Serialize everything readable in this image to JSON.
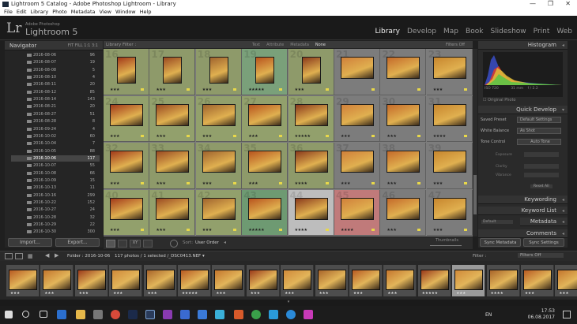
{
  "window": {
    "title": "Lightroom 5 Catalog - Adobe Photoshop Lightroom - Library",
    "min": "—",
    "max": "❐",
    "close": "✕"
  },
  "menu": [
    "File",
    "Edit",
    "Library",
    "Photo",
    "Metadata",
    "View",
    "Window",
    "Help"
  ],
  "identity": {
    "logo": "Lr",
    "brand_small": "Adobe Photoshop",
    "brand_large": "Lightroom 5"
  },
  "modules": [
    "Library",
    "Develop",
    "Map",
    "Book",
    "Slideshow",
    "Print",
    "Web"
  ],
  "navigator": {
    "title": "Navigator",
    "zoom_options": "FIT  FILL  1:1  3:1"
  },
  "folders": [
    {
      "name": "2016-08-06",
      "count": "96"
    },
    {
      "name": "2016-08-07",
      "count": "19"
    },
    {
      "name": "2016-08-08",
      "count": "5"
    },
    {
      "name": "2016-08-10",
      "count": "4"
    },
    {
      "name": "2016-08-11",
      "count": "20"
    },
    {
      "name": "2016-08-12",
      "count": "85"
    },
    {
      "name": "2016-08-14",
      "count": "143"
    },
    {
      "name": "2016-08-21",
      "count": "20"
    },
    {
      "name": "2016-08-27",
      "count": "51"
    },
    {
      "name": "2016-08-28",
      "count": "8"
    },
    {
      "name": "2016-09-24",
      "count": "4"
    },
    {
      "name": "2016-10-02",
      "count": "60"
    },
    {
      "name": "2016-10-04",
      "count": "7"
    },
    {
      "name": "2016-10-05",
      "count": "88"
    },
    {
      "name": "2016-10-06",
      "count": "117"
    },
    {
      "name": "2016-10-07",
      "count": "55"
    },
    {
      "name": "2016-10-08",
      "count": "66"
    },
    {
      "name": "2016-10-09",
      "count": "15"
    },
    {
      "name": "2016-10-13",
      "count": "11"
    },
    {
      "name": "2016-10-16",
      "count": "299"
    },
    {
      "name": "2016-10-22",
      "count": "152"
    },
    {
      "name": "2016-10-27",
      "count": "24"
    },
    {
      "name": "2016-10-28",
      "count": "32"
    },
    {
      "name": "2016-10-29",
      "count": "22"
    },
    {
      "name": "2016-10-30",
      "count": "300"
    }
  ],
  "selected_folder_index": 14,
  "left_buttons": {
    "import": "Import...",
    "export": "Export..."
  },
  "filterbar": {
    "label": "Library Filter :",
    "tabs": [
      "Text",
      "Attribute",
      "Metadata",
      "None"
    ],
    "active_tab": "None",
    "filters": "Filters Off"
  },
  "grid_numbers": [
    "16",
    "17",
    "18",
    "19",
    "20",
    "21",
    "22",
    "23",
    "24",
    "25",
    "26",
    "27",
    "28",
    "29",
    "30",
    "31",
    "32",
    "33",
    "34",
    "35",
    "36",
    "37",
    "38",
    "39",
    "40",
    "41",
    "42",
    "43",
    "44",
    "45",
    "46",
    "47"
  ],
  "grid_stars": [
    "★★★",
    "★★★",
    "★★★",
    "★★★★★",
    "★★★",
    "",
    "",
    "★★★",
    "★★★",
    "★★★",
    "★★★",
    "★★★",
    "★★★★★",
    "★★★",
    "★★★",
    "★★★★",
    "★★★",
    "★★★",
    "★★★",
    "★★★",
    "★★★★",
    "★★★",
    "★★★",
    "★★★",
    "★★★",
    "★★★",
    "★★★",
    "★★★★★",
    "★★★★",
    "★★★★",
    "★★★",
    "★★★"
  ],
  "grid_toolbar": {
    "sort_label": "Sort:",
    "sort_value": "User Order",
    "thumbs_label": "Thumbnails"
  },
  "right": {
    "histogram": "Histogram",
    "exif": {
      "iso": "ISO 720",
      "focal": "31 mm",
      "aperture": "f / 2.2",
      "shutter": "1/60 sec"
    },
    "original_photo": "Original Photo",
    "quick_develop": "Quick Develop",
    "saved_preset_label": "Saved Preset",
    "saved_preset": "Default Settings",
    "wb_label": "White Balance",
    "wb_value": "As Shot",
    "tone_label": "Tone Control",
    "auto_tone": "Auto Tone",
    "exposure": "Exposure",
    "clarity": "Clarity",
    "vibrance": "Vibrance",
    "reset": "Reset All",
    "keywording": "Keywording",
    "keyword_list": "Keyword List",
    "default": "Default",
    "metadata": "Metadata",
    "comments": "Comments",
    "sync_meta": "Sync Metadata",
    "sync_settings": "Sync Settings"
  },
  "filmbar": {
    "folder": "Folder : 2016-10-06",
    "count": "117 photos / 1 selected /_DSC0413.NEF ▾",
    "filter_label": "Filter :",
    "filter_value": "Filters Off"
  },
  "film_stars": [
    "★★★",
    "★★★",
    "★★★",
    "★★★",
    "★★★",
    "★★★★★",
    "★★★",
    "★★★",
    "★★★",
    "★★★",
    "★★★",
    "★★★",
    "★★★★★",
    "★★★",
    "★★★★",
    "★★★",
    "★★★"
  ],
  "clock": {
    "time": "17:53",
    "date": "06.08.2017",
    "lang": "EN"
  }
}
